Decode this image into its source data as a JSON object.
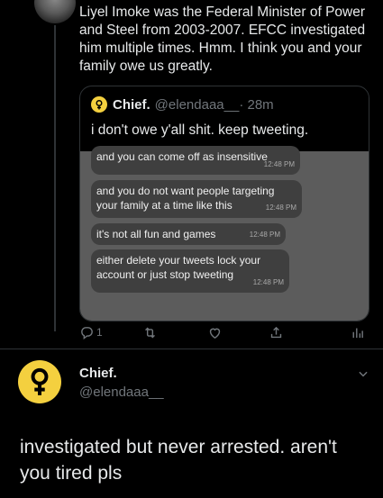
{
  "thread_tweet": {
    "text": "Liyel Imoke was the Federal Minister of Power and Steel from 2003-2007. EFCC investigated him multiple times.  Hmm. I think you and your family owe us greatly."
  },
  "quote_tweet": {
    "name": "Chief.",
    "handle": "@elendaaa__",
    "time": "· 28m",
    "text": "i don't owe y'all shit. keep tweeting.",
    "messages": [
      {
        "text": "and you can come off as insensitive",
        "time": "12:48 PM"
      },
      {
        "text": "and you do not want people targeting your family at a time like this",
        "time": "12:48 PM"
      },
      {
        "text": "it's not all fun and games",
        "time": "12:48 PM"
      },
      {
        "text": "either delete your tweets lock your account or just stop tweeting",
        "time": "12:48 PM"
      }
    ]
  },
  "actions": {
    "reply_count": "1",
    "icons": [
      "reply-icon",
      "retweet-icon",
      "like-icon",
      "share-icon",
      "analytics-icon"
    ]
  },
  "main_tweet": {
    "name": "Chief.",
    "handle": "@elendaaa__",
    "text": "investigated but never arrested. aren't you tired pls"
  },
  "colors": {
    "background": "#000000",
    "text": "#e7e9ea",
    "muted": "#71767b",
    "avatar_yellow": "#f4d03f",
    "screenshot_gray": "#5c5c5c",
    "bubble_gray": "#3f3f3f"
  }
}
